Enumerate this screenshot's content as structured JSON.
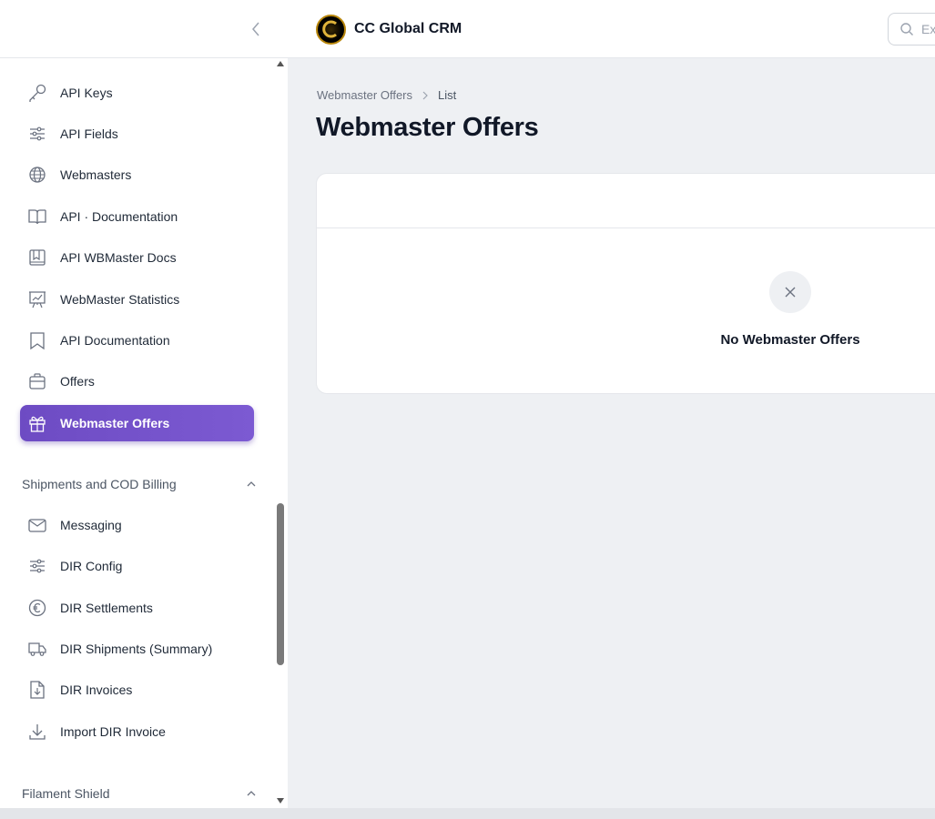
{
  "app": {
    "name": "CC Global CRM"
  },
  "search": {
    "placeholder": "Ex"
  },
  "sidebar": {
    "items": [
      {
        "label": "API Keys",
        "icon": "key-icon"
      },
      {
        "label": "API Fields",
        "icon": "sliders-icon"
      },
      {
        "label": "Webmasters",
        "icon": "globe-icon"
      },
      {
        "label": "API · Documentation",
        "icon": "book-open-icon"
      },
      {
        "label": "API WBMaster Docs",
        "icon": "book-icon"
      },
      {
        "label": "WebMaster Statistics",
        "icon": "presentation-chart-icon"
      },
      {
        "label": "API Documentation",
        "icon": "bookmark-icon"
      },
      {
        "label": "Offers",
        "icon": "briefcase-icon"
      },
      {
        "label": "Webmaster Offers",
        "icon": "gift-icon",
        "active": true
      }
    ],
    "groups": [
      {
        "label": "Shipments and COD Billing",
        "items": [
          {
            "label": "Messaging",
            "icon": "envelope-icon"
          },
          {
            "label": "DIR Config",
            "icon": "sliders-icon"
          },
          {
            "label": "DIR Settlements",
            "icon": "euro-icon"
          },
          {
            "label": "DIR Shipments (Summary)",
            "icon": "truck-icon"
          },
          {
            "label": "DIR Invoices",
            "icon": "document-download-icon"
          },
          {
            "label": "Import DIR Invoice",
            "icon": "arrow-down-tray-icon"
          }
        ]
      },
      {
        "label": "Filament Shield",
        "items": []
      }
    ]
  },
  "breadcrumb": {
    "parent": "Webmaster Offers",
    "current": "List"
  },
  "page": {
    "title": "Webmaster Offers"
  },
  "table": {
    "empty_text": "No Webmaster Offers"
  },
  "colors": {
    "accent": "#7053c9",
    "background": "#eef0f3"
  }
}
